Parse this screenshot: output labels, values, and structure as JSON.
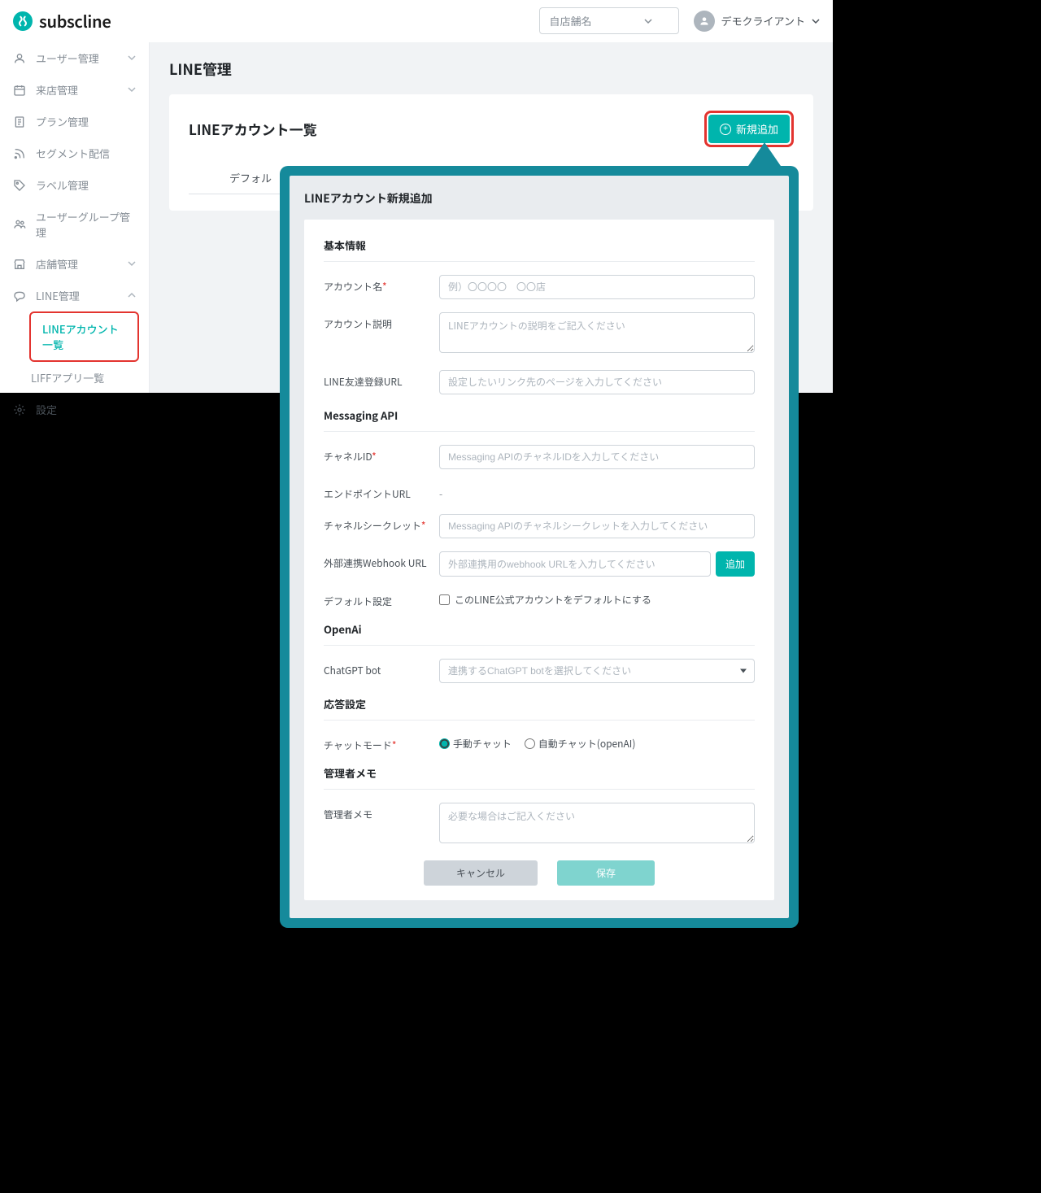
{
  "brand": "subscline",
  "header": {
    "store_placeholder": "自店舗名",
    "user_name": "デモクライアント"
  },
  "sidebar": {
    "items": [
      {
        "label": "ユーザー管理",
        "expandable": true
      },
      {
        "label": "来店管理",
        "expandable": true
      },
      {
        "label": "プラン管理",
        "expandable": false
      },
      {
        "label": "セグメント配信",
        "expandable": false
      },
      {
        "label": "ラベル管理",
        "expandable": false
      },
      {
        "label": "ユーザーグループ管理",
        "expandable": false
      },
      {
        "label": "店舗管理",
        "expandable": true
      },
      {
        "label": "LINE管理",
        "expandable": true,
        "expanded": true
      }
    ],
    "line_sub": [
      {
        "label": "LINEアカウント一覧",
        "active": true
      },
      {
        "label": "LIFFアプリ一覧",
        "active": false
      }
    ],
    "settings_label": "設定"
  },
  "page": {
    "title": "LINE管理",
    "card_title": "LINEアカウント一覧",
    "add_button": "新規追加",
    "tab_default": "デフォル"
  },
  "modal": {
    "title": "LINEアカウント新規追加",
    "sections": {
      "basic": "基本情報",
      "messaging": "Messaging API",
      "openai": "OpenAi",
      "reply": "応答設定",
      "memo": "管理者メモ"
    },
    "fields": {
      "account_name": {
        "label": "アカウント名",
        "placeholder": "例）〇〇〇〇　〇〇店"
      },
      "account_desc": {
        "label": "アカウント説明",
        "placeholder": "LINEアカウントの説明をご記入ください"
      },
      "friend_url": {
        "label": "LINE友達登録URL",
        "placeholder": "設定したいリンク先のページを入力してください"
      },
      "channel_id": {
        "label": "チャネルID",
        "placeholder": "Messaging APIのチャネルIDを入力してください"
      },
      "endpoint": {
        "label": "エンドポイントURL",
        "value": "-"
      },
      "channel_secret": {
        "label": "チャネルシークレット",
        "placeholder": "Messaging APIのチャネルシークレットを入力してください"
      },
      "webhook": {
        "label": "外部連携Webhook URL",
        "placeholder": "外部連携用のwebhook URLを入力してください",
        "add_btn": "追加"
      },
      "default_setting": {
        "label": "デフォルト設定",
        "checkbox": "このLINE公式アカウントをデフォルトにする"
      },
      "chatgpt": {
        "label": "ChatGPT bot",
        "placeholder": "連携するChatGPT botを選択してください"
      },
      "chat_mode": {
        "label": "チャットモード",
        "opt_manual": "手動チャット",
        "opt_auto": "自動チャット(openAI)"
      },
      "admin_memo": {
        "label": "管理者メモ",
        "placeholder": "必要な場合はご記入ください"
      }
    },
    "actions": {
      "cancel": "キャンセル",
      "save": "保存"
    }
  }
}
